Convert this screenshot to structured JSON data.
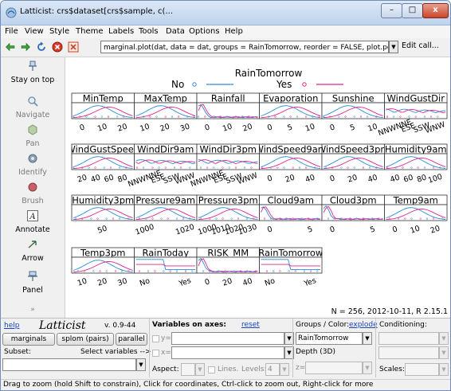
{
  "window": {
    "title": "Latticist: crs$dataset[crs$sample, c(...",
    "minimize": "–",
    "maximize": "□",
    "close": "x"
  },
  "menu": [
    "File",
    "View",
    "Style",
    "Theme",
    "Labels",
    "Tools",
    "Data",
    "Options",
    "Help"
  ],
  "toolbar": {
    "icons": [
      "back-icon",
      "forward-icon",
      "refresh-icon",
      "stop-icon",
      "close-plot-icon"
    ],
    "call_text": "marginal.plot(dat, data = dat, groups = RainTomorrow, reorder = FALSE, plot.points = \"jit",
    "edit_call": "Edit call..."
  },
  "sidebar": [
    {
      "name": "stay-on-top",
      "label": "Stay on top",
      "icon": "pin-icon",
      "disabled": false
    },
    {
      "name": "navigate",
      "label": "Navigate",
      "icon": "magnifier-icon",
      "disabled": true
    },
    {
      "name": "pan",
      "label": "Pan",
      "icon": "pan-icon",
      "disabled": true
    },
    {
      "name": "identify",
      "label": "Identify",
      "icon": "identify-icon",
      "disabled": true
    },
    {
      "name": "brush",
      "label": "Brush",
      "icon": "brush-icon",
      "disabled": true
    },
    {
      "name": "annotate",
      "label": "Annotate",
      "icon": "text-a-icon",
      "disabled": false
    },
    {
      "name": "arrow",
      "label": "Arrow",
      "icon": "arrow-icon",
      "disabled": false
    },
    {
      "name": "panel",
      "label": "Panel",
      "icon": "panel-icon",
      "disabled": false
    }
  ],
  "sidebar_more": "»",
  "chart_data": {
    "type": "line",
    "legend_title": "RainTomorrow",
    "legend": [
      {
        "name": "No",
        "color": "#2b8bd8"
      },
      {
        "name": "Yes",
        "color": "#e0248e"
      }
    ],
    "panels": [
      {
        "title": "MinTemp",
        "ticks": [
          "0",
          "10",
          "20"
        ],
        "kind": "density"
      },
      {
        "title": "MaxTemp",
        "ticks": [
          "10",
          "20",
          "30"
        ],
        "kind": "density"
      },
      {
        "title": "Rainfall",
        "ticks": [
          "0",
          "10",
          "20"
        ],
        "kind": "spike"
      },
      {
        "title": "Evaporation",
        "ticks": [
          "0",
          "5",
          "10"
        ],
        "kind": "density"
      },
      {
        "title": "Sunshine",
        "ticks": [
          "0",
          "5",
          "10"
        ],
        "kind": "density"
      },
      {
        "title": "WindGustDir",
        "ticks": [
          "NNWNNE",
          "ESE",
          "SSW",
          "WNW"
        ],
        "kind": "category"
      },
      {
        "title": "WindGustSpeed",
        "ticks": [
          "20",
          "40",
          "60",
          "80"
        ],
        "kind": "density"
      },
      {
        "title": "WindDir9am",
        "ticks": [
          "NNWNNE",
          "ESE",
          "SSW",
          "WNW"
        ],
        "kind": "category"
      },
      {
        "title": "WindDir3pm",
        "ticks": [
          "NNWNNE",
          "ESE",
          "SSW",
          "WNW"
        ],
        "kind": "category"
      },
      {
        "title": "WindSpeed9am",
        "ticks": [
          "0",
          "20",
          "40"
        ],
        "kind": "density"
      },
      {
        "title": "WindSpeed3pm",
        "ticks": [
          "0",
          "20",
          "40"
        ],
        "kind": "density"
      },
      {
        "title": "Humidity9am",
        "ticks": [
          "40",
          "60",
          "80",
          "100"
        ],
        "kind": "density"
      },
      {
        "title": "Humidity3pm",
        "ticks": [
          "50"
        ],
        "kind": "density"
      },
      {
        "title": "Pressure9am",
        "ticks": [
          "1000",
          "1020"
        ],
        "kind": "density"
      },
      {
        "title": "Pressure3pm",
        "ticks": [
          "1000",
          "1010",
          "1020",
          "1030"
        ],
        "kind": "density"
      },
      {
        "title": "Cloud9am",
        "ticks": [
          "0",
          "5"
        ],
        "kind": "spike"
      },
      {
        "title": "Cloud3pm",
        "ticks": [
          "0",
          "5"
        ],
        "kind": "spike"
      },
      {
        "title": "Temp9am",
        "ticks": [
          "0",
          "10",
          "20"
        ],
        "kind": "density"
      },
      {
        "title": "Temp3pm",
        "ticks": [
          "10",
          "20",
          "30"
        ],
        "kind": "density"
      },
      {
        "title": "RainToday",
        "ticks": [
          "No",
          "Yes"
        ],
        "kind": "bar2"
      },
      {
        "title": "RISK_MM",
        "ticks": [
          "0",
          "20",
          "40"
        ],
        "kind": "spike"
      },
      {
        "title": "RainTomorrow",
        "ticks": [
          "No",
          "Yes"
        ],
        "kind": "bar2"
      }
    ],
    "footer": "N = 256, 2012-10-11, R 2.15.1"
  },
  "bottom": {
    "help": "help",
    "brand": "Latticist",
    "version": "v. 0.9-44",
    "marginals": "marginals",
    "splom": "splom (pairs)",
    "parallel": "parallel",
    "subset_label": "Subset:",
    "select_vars": "Select variables -->",
    "vars_on_axes": "Variables on axes:",
    "reset": "reset",
    "y_label": "y=",
    "x_label": "x=",
    "aspect_label": "Aspect:",
    "lines_label": "Lines.",
    "levels_label": "Levels:",
    "levels_value": "4",
    "groups_label": "Groups / Color:",
    "explode": "explode",
    "groups_value": "RainTomorrow",
    "depth_label": "Depth (3D)",
    "z_label": "z=",
    "conditioning": "Conditioning:",
    "scales_label": "Scales:"
  },
  "statusbar": "Drag to zoom (hold Shift to constrain), Click for coordinates, Ctrl-click to zoom out, Right-click for more"
}
